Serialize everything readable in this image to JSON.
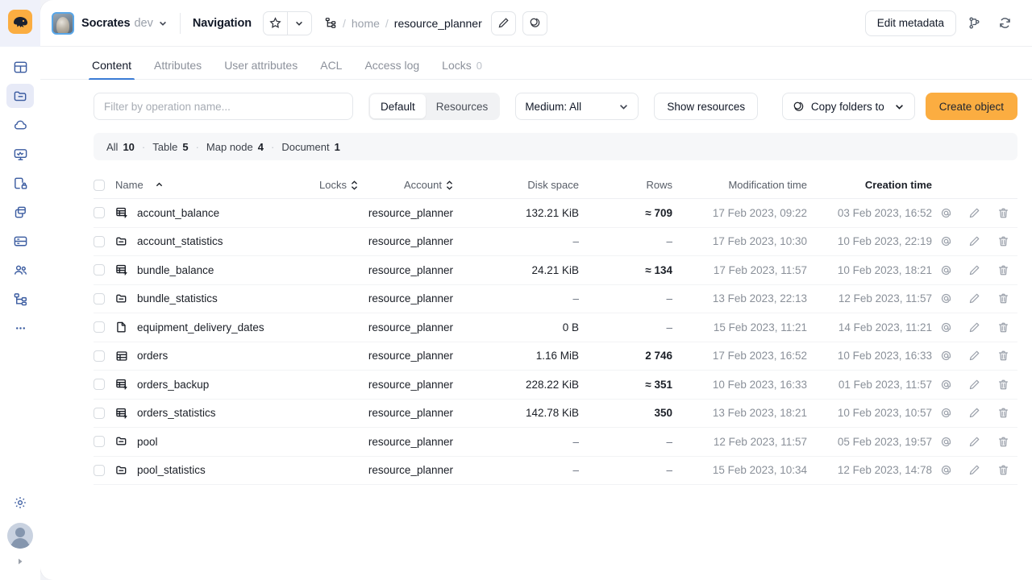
{
  "rail": {
    "logo": "logo-icon",
    "items": [
      {
        "name": "dashboard",
        "icon": "dashboard-icon",
        "active": false
      },
      {
        "name": "navigation",
        "icon": "folder-icon",
        "active": true
      },
      {
        "name": "cloud",
        "icon": "cloud-icon",
        "active": false
      },
      {
        "name": "monitoring",
        "icon": "monitor-icon",
        "active": false
      },
      {
        "name": "accounts-security",
        "icon": "lock-db-icon",
        "active": false
      },
      {
        "name": "storage",
        "icon": "database-stack-icon",
        "active": false
      },
      {
        "name": "queries",
        "icon": "server-icon",
        "active": false
      },
      {
        "name": "users",
        "icon": "people-icon",
        "active": false
      },
      {
        "name": "scheduler",
        "icon": "tree-icon",
        "active": false
      },
      {
        "name": "more",
        "icon": "ellipsis-icon",
        "active": false
      }
    ],
    "settings_icon": "gear-icon",
    "avatar": "user-avatar",
    "collapse_icon": "chevron-right-icon"
  },
  "header": {
    "cluster": "Socrates",
    "env": "dev",
    "caret_icon": "chevron-down-icon",
    "nav_label": "Navigation",
    "star_icon": "star-icon",
    "star_caret_icon": "chevron-down-icon",
    "path_icon": "path-tree-icon",
    "breadcrumb": [
      "home",
      "resource_planner"
    ],
    "breadcrumb_sep": "/",
    "edit_path_icon": "pencil-icon",
    "copy_path_icon": "copy-icon",
    "edit_metadata_label": "Edit metadata",
    "branch_icon": "branch-icon",
    "refresh_icon": "refresh-icon"
  },
  "tabs": [
    {
      "label": "Content",
      "count": "",
      "active": true
    },
    {
      "label": "Attributes",
      "count": "",
      "active": false
    },
    {
      "label": "User attributes",
      "count": "",
      "active": false
    },
    {
      "label": "ACL",
      "count": "",
      "active": false
    },
    {
      "label": "Access log",
      "count": "",
      "active": false
    },
    {
      "label": "Locks",
      "count": "0",
      "active": false
    }
  ],
  "toolbar": {
    "filter_placeholder": "Filter by operation name...",
    "filter_value": "",
    "segments": [
      {
        "label": "Default",
        "active": true
      },
      {
        "label": "Resources",
        "active": false
      }
    ],
    "medium_label": "Medium: All",
    "medium_caret_icon": "chevron-down-icon",
    "show_resources_label": "Show resources",
    "copy_folders_label": "Copy folders to",
    "copy_folders_icon": "copy-folders-icon",
    "copy_folders_caret_icon": "chevron-down-icon",
    "create_object_label": "Create object",
    "accent_color": "#FBAD41"
  },
  "summary": {
    "items": [
      {
        "label": "All",
        "count": "10"
      },
      {
        "label": "Table",
        "count": "5"
      },
      {
        "label": "Map node",
        "count": "4"
      },
      {
        "label": "Document",
        "count": "1"
      }
    ],
    "separator": "·"
  },
  "table": {
    "columns": {
      "name": "Name",
      "locks": "Locks",
      "account": "Account",
      "disk_space": "Disk space",
      "rows": "Rows",
      "modification_time": "Modification time",
      "creation_time": "Creation time"
    },
    "sort_asc_icon": "sort-asc-icon",
    "sort_icon": "sort-icon",
    "row_actions": [
      {
        "name": "link-icon",
        "glyph": "@"
      },
      {
        "name": "pencil-icon",
        "glyph": "pencil"
      },
      {
        "name": "trash-icon",
        "glyph": "trash"
      }
    ],
    "rows": [
      {
        "icon": "dynamic-table-icon",
        "name": "account_balance",
        "locks": "",
        "account": "resource_planner",
        "disk": "132.21 KiB",
        "rows": "≈ 709",
        "mod": "17 Feb 2023, 09:22",
        "created": "03 Feb 2023,  16:52"
      },
      {
        "icon": "map-node-icon",
        "name": "account_statistics",
        "locks": "",
        "account": "resource_planner",
        "disk": "–",
        "rows": "–",
        "mod": "17 Feb 2023,  10:30",
        "created": "10 Feb 2023, 22:19"
      },
      {
        "icon": "dynamic-table-icon",
        "name": "bundle_balance",
        "locks": "",
        "account": "resource_planner",
        "disk": "24.21 KiB",
        "rows": "≈ 134",
        "mod": "17 Feb 2023, 11:57",
        "created": "10 Feb 2023, 18:21"
      },
      {
        "icon": "map-node-icon",
        "name": "bundle_statistics",
        "locks": "",
        "account": "resource_planner",
        "disk": "–",
        "rows": "–",
        "mod": "13 Feb 2023, 22:13",
        "created": "12 Feb 2023, 11:57"
      },
      {
        "icon": "document-icon",
        "name": "equipment_delivery_dates",
        "locks": "",
        "account": "resource_planner",
        "disk": "0 B",
        "rows": "–",
        "mod": "15 Feb 2023, 11:21",
        "created": "14 Feb 2023, 11:21"
      },
      {
        "icon": "table-icon",
        "name": "orders",
        "locks": "",
        "account": "resource_planner",
        "disk": "1.16 MiB",
        "rows": "2 746",
        "mod": "17 Feb 2023, 16:52",
        "created": "10 Feb 2023, 16:33"
      },
      {
        "icon": "dynamic-table-icon",
        "name": "orders_backup",
        "locks": "",
        "account": "resource_planner",
        "disk": "228.22 KiB",
        "rows": "≈ 351",
        "mod": "10 Feb 2023, 16:33",
        "created": "01 Feb 2023, 11:57"
      },
      {
        "icon": "dynamic-table-icon",
        "name": "orders_statistics",
        "locks": "",
        "account": "resource_planner",
        "disk": "142.78 KiB",
        "rows": "350",
        "mod": "13 Feb 2023, 18:21",
        "created": "10 Feb 2023, 10:57"
      },
      {
        "icon": "map-node-icon",
        "name": "pool",
        "locks": "",
        "account": "resource_planner",
        "disk": "–",
        "rows": "–",
        "mod": "12 Feb 2023, 11:57",
        "created": "05 Feb 2023, 19:57"
      },
      {
        "icon": "map-node-icon",
        "name": "pool_statistics",
        "locks": "",
        "account": "resource_planner",
        "disk": "–",
        "rows": "–",
        "mod": "15 Feb 2023, 10:34",
        "created": "12 Feb 2023, 14:78"
      }
    ]
  }
}
